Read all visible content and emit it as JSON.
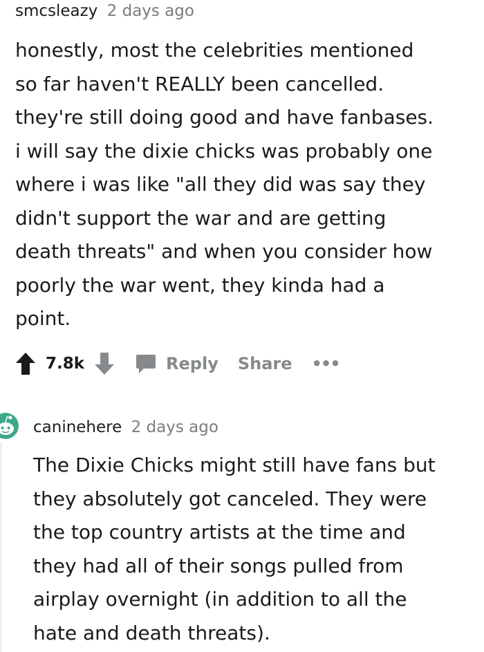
{
  "comment1": {
    "username": "smcsleazy",
    "time": "2 days ago",
    "lines": [
      "honestly, most the celebrities mentioned",
      "so far haven't REALLY been cancelled.",
      "they're still doing good and have fanbases.",
      "i will say the dixie chicks was probably one",
      "where i was like \"all they did was say they",
      "didn't support the war and are getting",
      "death threats\" and when you consider how",
      "poorly the war went, they kinda had a",
      "point."
    ],
    "score": "7.8k",
    "reply_label": "Reply",
    "share_label": "Share",
    "more_label": "•••"
  },
  "comment2": {
    "username": "caninehere",
    "time": "2 days ago",
    "lines": [
      "The Dixie Chicks might still have fans but",
      "they absolutely got canceled. They were",
      "the top country artists at the time and",
      "they had all of their songs pulled from",
      "airplay overnight (in addition to all the",
      "hate and death threats)."
    ]
  },
  "colors": {
    "text": "#1a1a1b",
    "meta_grey": "#7c7c7c",
    "action_grey": "#878a8c",
    "avatar_green": "#3ea88a",
    "thread_line": "#edeff1"
  },
  "icons": {
    "upvote": "arrow-up-icon",
    "downvote": "arrow-down-icon",
    "reply": "comment-bubble-icon",
    "avatar": "snoo-avatar-icon"
  }
}
